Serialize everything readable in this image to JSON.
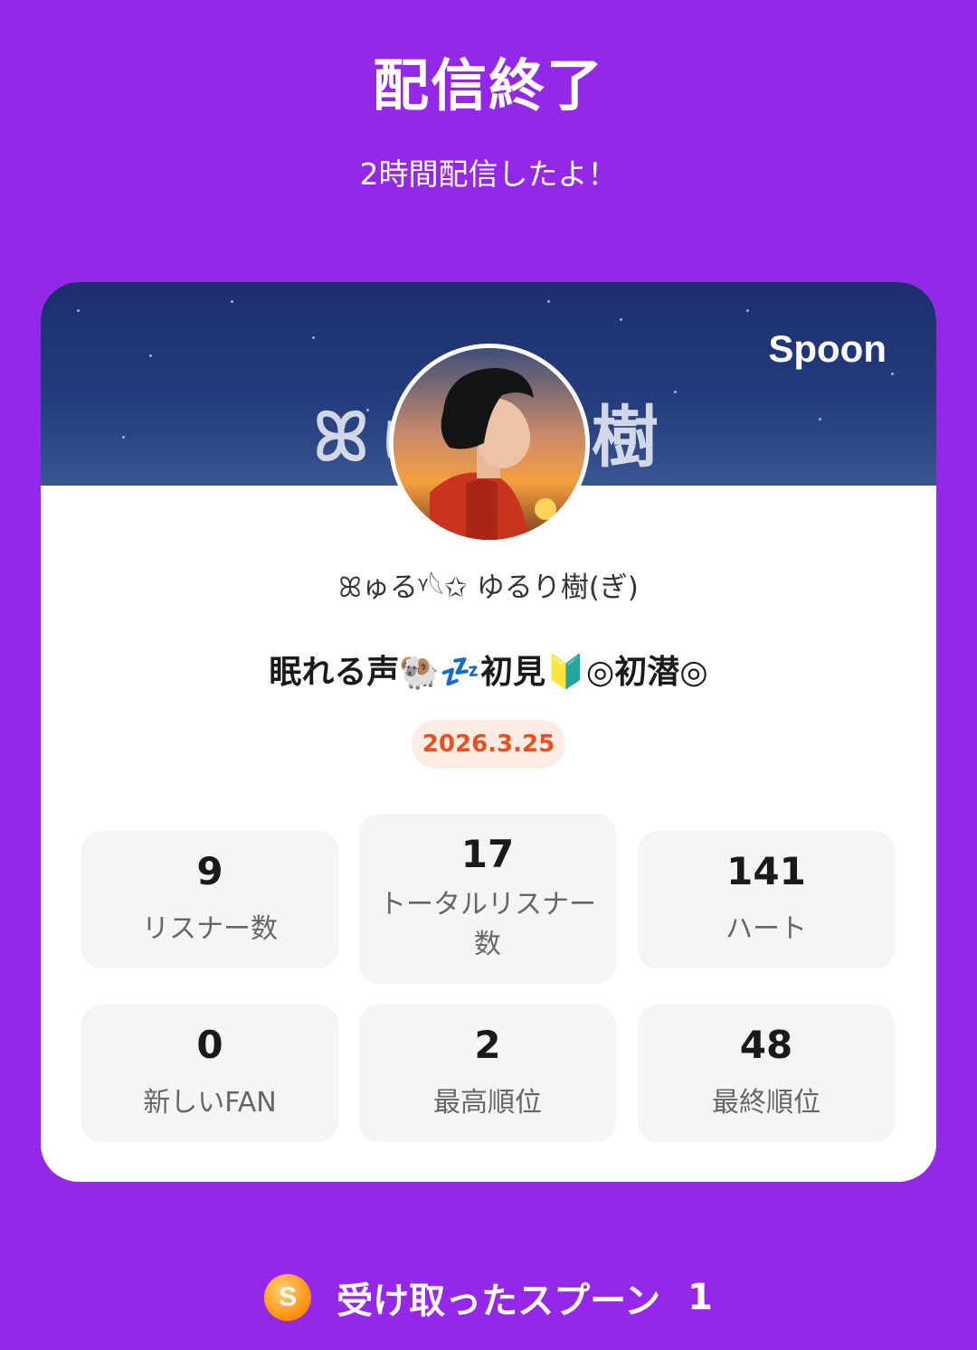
{
  "header": {
    "title": "配信終了",
    "subtitle": "2時間配信したよ！"
  },
  "card": {
    "banner_text": "ꕤゅるり樹",
    "brand": "Spoon",
    "username": "ꕤゅるᵞ𓆩✩ ゆるり樹(ぎ)",
    "room_title": "眠れる声🐏💤初見🔰◎初潜◎",
    "date": "2026.3.25",
    "stats": [
      {
        "value": "9",
        "label": "リスナー数"
      },
      {
        "value": "17",
        "label": "トータルリスナー数"
      },
      {
        "value": "141",
        "label": "ハート"
      },
      {
        "value": "0",
        "label": "新しいFAN"
      },
      {
        "value": "2",
        "label": "最高順位"
      },
      {
        "value": "48",
        "label": "最終順位"
      }
    ]
  },
  "spoons": {
    "coin_letter": "S",
    "label": "受け取ったスプーン",
    "count": "1"
  },
  "colors": {
    "background": "#9527e8",
    "accent": "#e8501e",
    "badge_bg": "#fdebe5"
  },
  "icons": {
    "coin": "spoon-coin-icon",
    "brand": "spoon-logo"
  }
}
